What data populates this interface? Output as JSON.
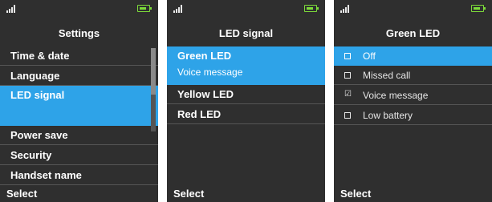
{
  "screens": [
    {
      "title": "Settings",
      "items": [
        "Time & date",
        "Language",
        "LED signal",
        "Power save",
        "Security",
        "Handset name"
      ],
      "selected_index": 2,
      "softkey": "Select"
    },
    {
      "title": "LED signal",
      "selected": {
        "label": "Green LED",
        "sublabel": "Voice message"
      },
      "items": [
        "Yellow LED",
        "Red LED"
      ],
      "softkey": "Select"
    },
    {
      "title": "Green LED",
      "options": [
        {
          "label": "Off",
          "checked": false,
          "selected": true
        },
        {
          "label": "Missed call",
          "checked": false,
          "selected": false
        },
        {
          "label": "Voice message",
          "checked": true,
          "selected": false
        },
        {
          "label": "Low battery",
          "checked": false,
          "selected": false
        }
      ],
      "softkey": "Select"
    }
  ],
  "colors": {
    "background": "#2f2f2f",
    "highlight": "#2ea3e8",
    "battery": "#7ddc3a"
  },
  "icons": {
    "signal": "signal-icon",
    "battery": "battery-icon",
    "checkbox": "checkbox-icon"
  }
}
